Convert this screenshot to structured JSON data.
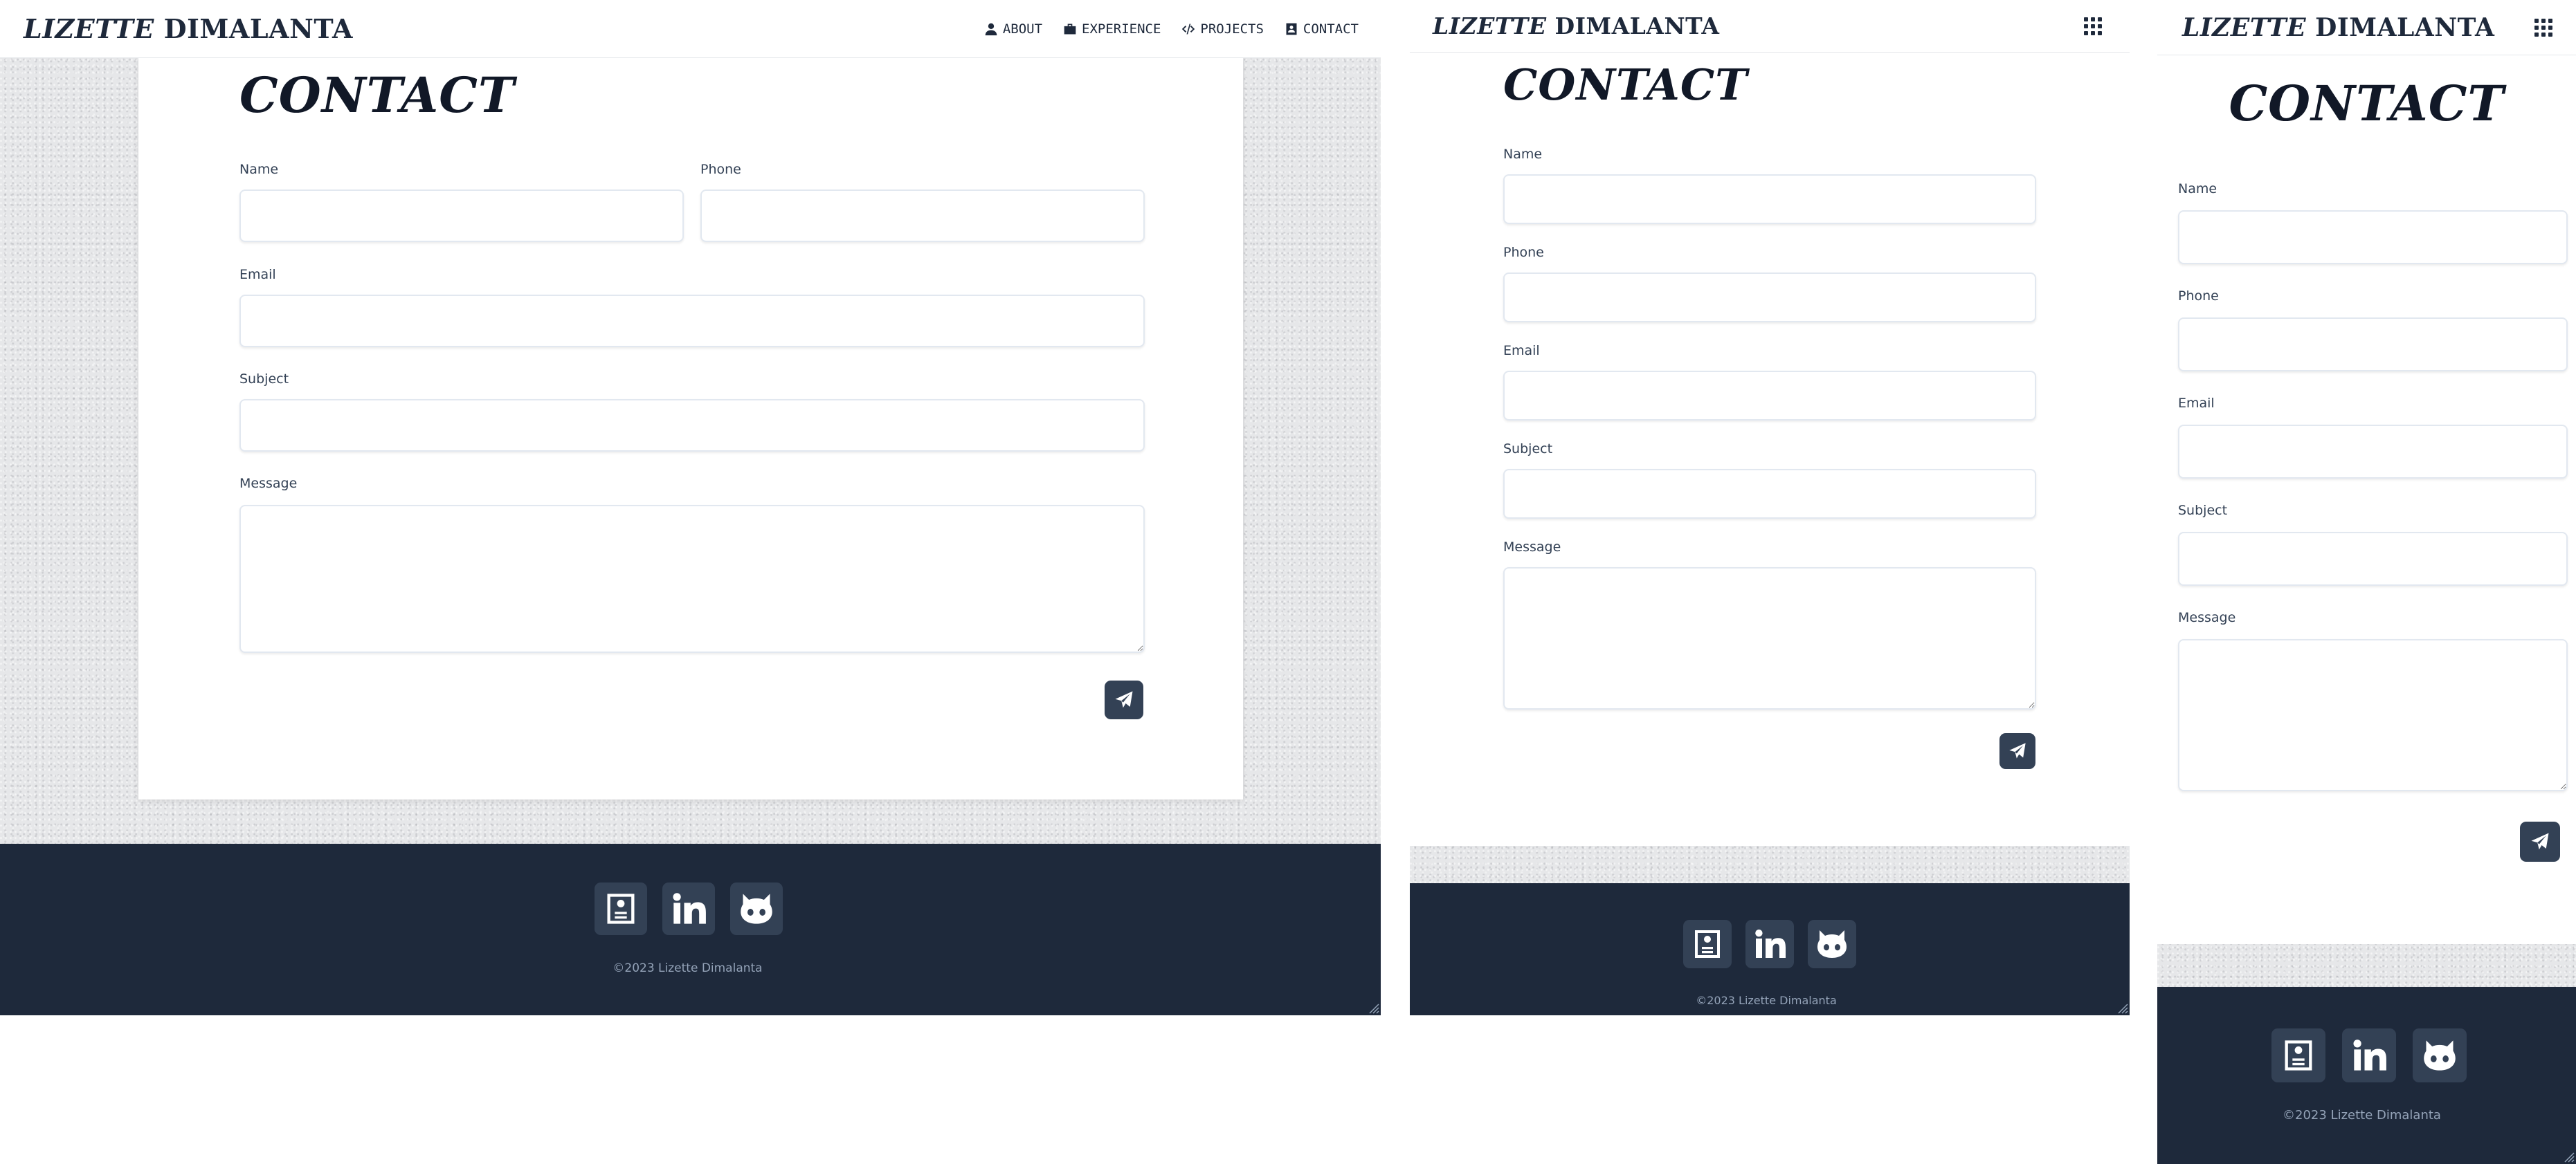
{
  "site": {
    "brand_first": "LIZETTE",
    "brand_last": "DIMALANTA"
  },
  "nav": {
    "items": [
      {
        "label": "ABOUT",
        "icon": "person-icon"
      },
      {
        "label": "EXPERIENCE",
        "icon": "briefcase-icon"
      },
      {
        "label": "PROJECTS",
        "icon": "code-icon"
      },
      {
        "label": "CONTACT",
        "icon": "contact-card-icon"
      }
    ],
    "menu_icon": "grid-menu-icon"
  },
  "contact": {
    "heading": "CONTACT",
    "name_label": "Name",
    "phone_label": "Phone",
    "email_label": "Email",
    "subject_label": "Subject",
    "message_label": "Message",
    "submit_icon": "paper-plane-icon"
  },
  "footer": {
    "socials": [
      "resume-icon",
      "linkedin-icon",
      "github-icon"
    ],
    "copyright": "©2023 Lizette Dimalanta"
  },
  "colors": {
    "navy": "#1e293b",
    "slate_button": "#334155",
    "wall": "#e6e7e9",
    "footer_text": "#94a3b8"
  }
}
